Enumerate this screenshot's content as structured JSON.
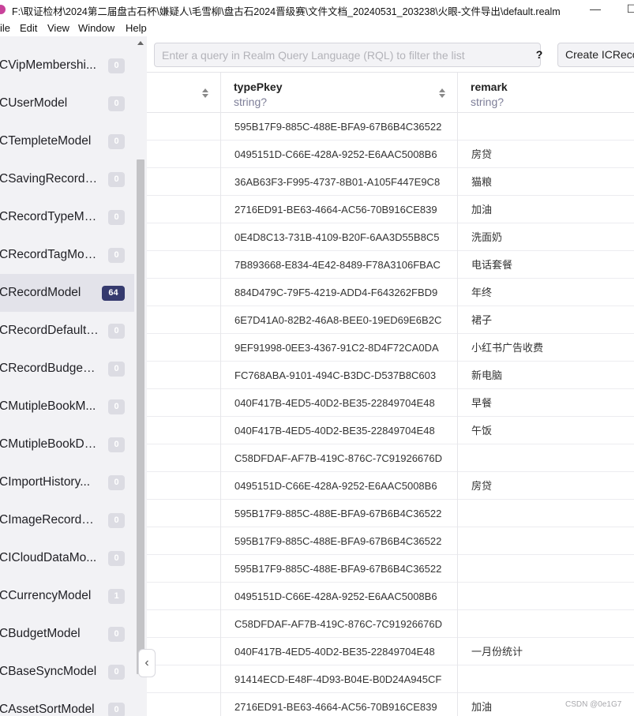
{
  "window": {
    "title": "F:\\取证检材\\2024第二届盘古石杯\\嫌疑人\\毛雪柳\\盘古石2024晋级赛\\文件文档_20240531_203238\\火眼-文件导出\\default.realm",
    "minimize": "—",
    "maximize": "☐"
  },
  "menu": [
    "ile",
    "Edit",
    "View",
    "Window",
    "Help"
  ],
  "sidebar": {
    "items": [
      {
        "label": "CVipMembershi...",
        "count": "0"
      },
      {
        "label": "CUserModel",
        "count": "0"
      },
      {
        "label": "CTempleteModel",
        "count": "0"
      },
      {
        "label": "CSavingRecordM...",
        "count": "0"
      },
      {
        "label": "CRecordTypeMo...",
        "count": "0"
      },
      {
        "label": "CRecordTagModel",
        "count": "0"
      },
      {
        "label": "CRecordModel",
        "count": "64",
        "active": true
      },
      {
        "label": "CRecordDefaultB...",
        "count": "0"
      },
      {
        "label": "CRecordBudgeM...",
        "count": "0"
      },
      {
        "label": "CMutipleBookM...",
        "count": "0"
      },
      {
        "label": "CMutipleBookDe...",
        "count": "0"
      },
      {
        "label": "CImportHistory...",
        "count": "0"
      },
      {
        "label": "CImageRecordM...",
        "count": "0"
      },
      {
        "label": "CICloudDataMo...",
        "count": "0"
      },
      {
        "label": "CCurrencyModel",
        "count": "1"
      },
      {
        "label": "CBudgetModel",
        "count": "0"
      },
      {
        "label": "CBaseSyncModel",
        "count": "0"
      },
      {
        "label": "CAssetSortModel",
        "count": "0"
      }
    ]
  },
  "query": {
    "placeholder": "Enter a query in Realm Query Language (RQL) to filter the list",
    "help_label": "?",
    "create_label": "Create ICRecordModel"
  },
  "table": {
    "columns": [
      {
        "name": "typePkey",
        "type": "string?"
      },
      {
        "name": "remark",
        "type": "string?"
      }
    ],
    "rows": [
      {
        "typePkey": "595B17F9-885C-488E-BFA9-67B6B4C36522",
        "remark": ""
      },
      {
        "typePkey": "0495151D-C66E-428A-9252-E6AAC5008B6",
        "remark": "房贷"
      },
      {
        "typePkey": "36AB63F3-F995-4737-8B01-A105F447E9C8",
        "remark": "猫粮"
      },
      {
        "typePkey": "2716ED91-BE63-4664-AC56-70B916CE839",
        "remark": "加油"
      },
      {
        "typePkey": "0E4D8C13-731B-4109-B20F-6AA3D55B8C5",
        "remark": "洗面奶"
      },
      {
        "typePkey": "7B893668-E834-4E42-8489-F78A3106FBAC",
        "remark": "电话套餐"
      },
      {
        "typePkey": "884D479C-79F5-4219-ADD4-F643262FBD9",
        "remark": "年终"
      },
      {
        "typePkey": "6E7D41A0-82B2-46A8-BEE0-19ED69E6B2C",
        "remark": "裙子"
      },
      {
        "typePkey": "9EF91998-0EE3-4367-91C2-8D4F72CA0DA",
        "remark": "小红书广告收费"
      },
      {
        "typePkey": "FC768ABA-9101-494C-B3DC-D537B8C603",
        "remark": "新电脑"
      },
      {
        "typePkey": "040F417B-4ED5-40D2-BE35-22849704E48",
        "remark": "早餐"
      },
      {
        "typePkey": "040F417B-4ED5-40D2-BE35-22849704E48",
        "remark": "午饭"
      },
      {
        "typePkey": "C58DFDAF-AF7B-419C-876C-7C91926676D",
        "remark": ""
      },
      {
        "typePkey": "0495151D-C66E-428A-9252-E6AAC5008B6",
        "remark": "房贷"
      },
      {
        "typePkey": "595B17F9-885C-488E-BFA9-67B6B4C36522",
        "remark": ""
      },
      {
        "typePkey": "595B17F9-885C-488E-BFA9-67B6B4C36522",
        "remark": ""
      },
      {
        "typePkey": "595B17F9-885C-488E-BFA9-67B6B4C36522",
        "remark": ""
      },
      {
        "typePkey": "0495151D-C66E-428A-9252-E6AAC5008B6",
        "remark": ""
      },
      {
        "typePkey": "C58DFDAF-AF7B-419C-876C-7C91926676D",
        "remark": ""
      },
      {
        "typePkey": "040F417B-4ED5-40D2-BE35-22849704E48",
        "remark": "一月份统计"
      },
      {
        "typePkey": "91414ECD-E48F-4D93-B04E-B0D24A945CF",
        "remark": ""
      },
      {
        "typePkey": "2716ED91-BE63-4664-AC56-70B916CE839",
        "remark": "加油"
      }
    ]
  },
  "watermark": "CSDN @0e1G7",
  "colors": {
    "active_badge": "#353a6e",
    "type_text": "#7d7e98"
  }
}
